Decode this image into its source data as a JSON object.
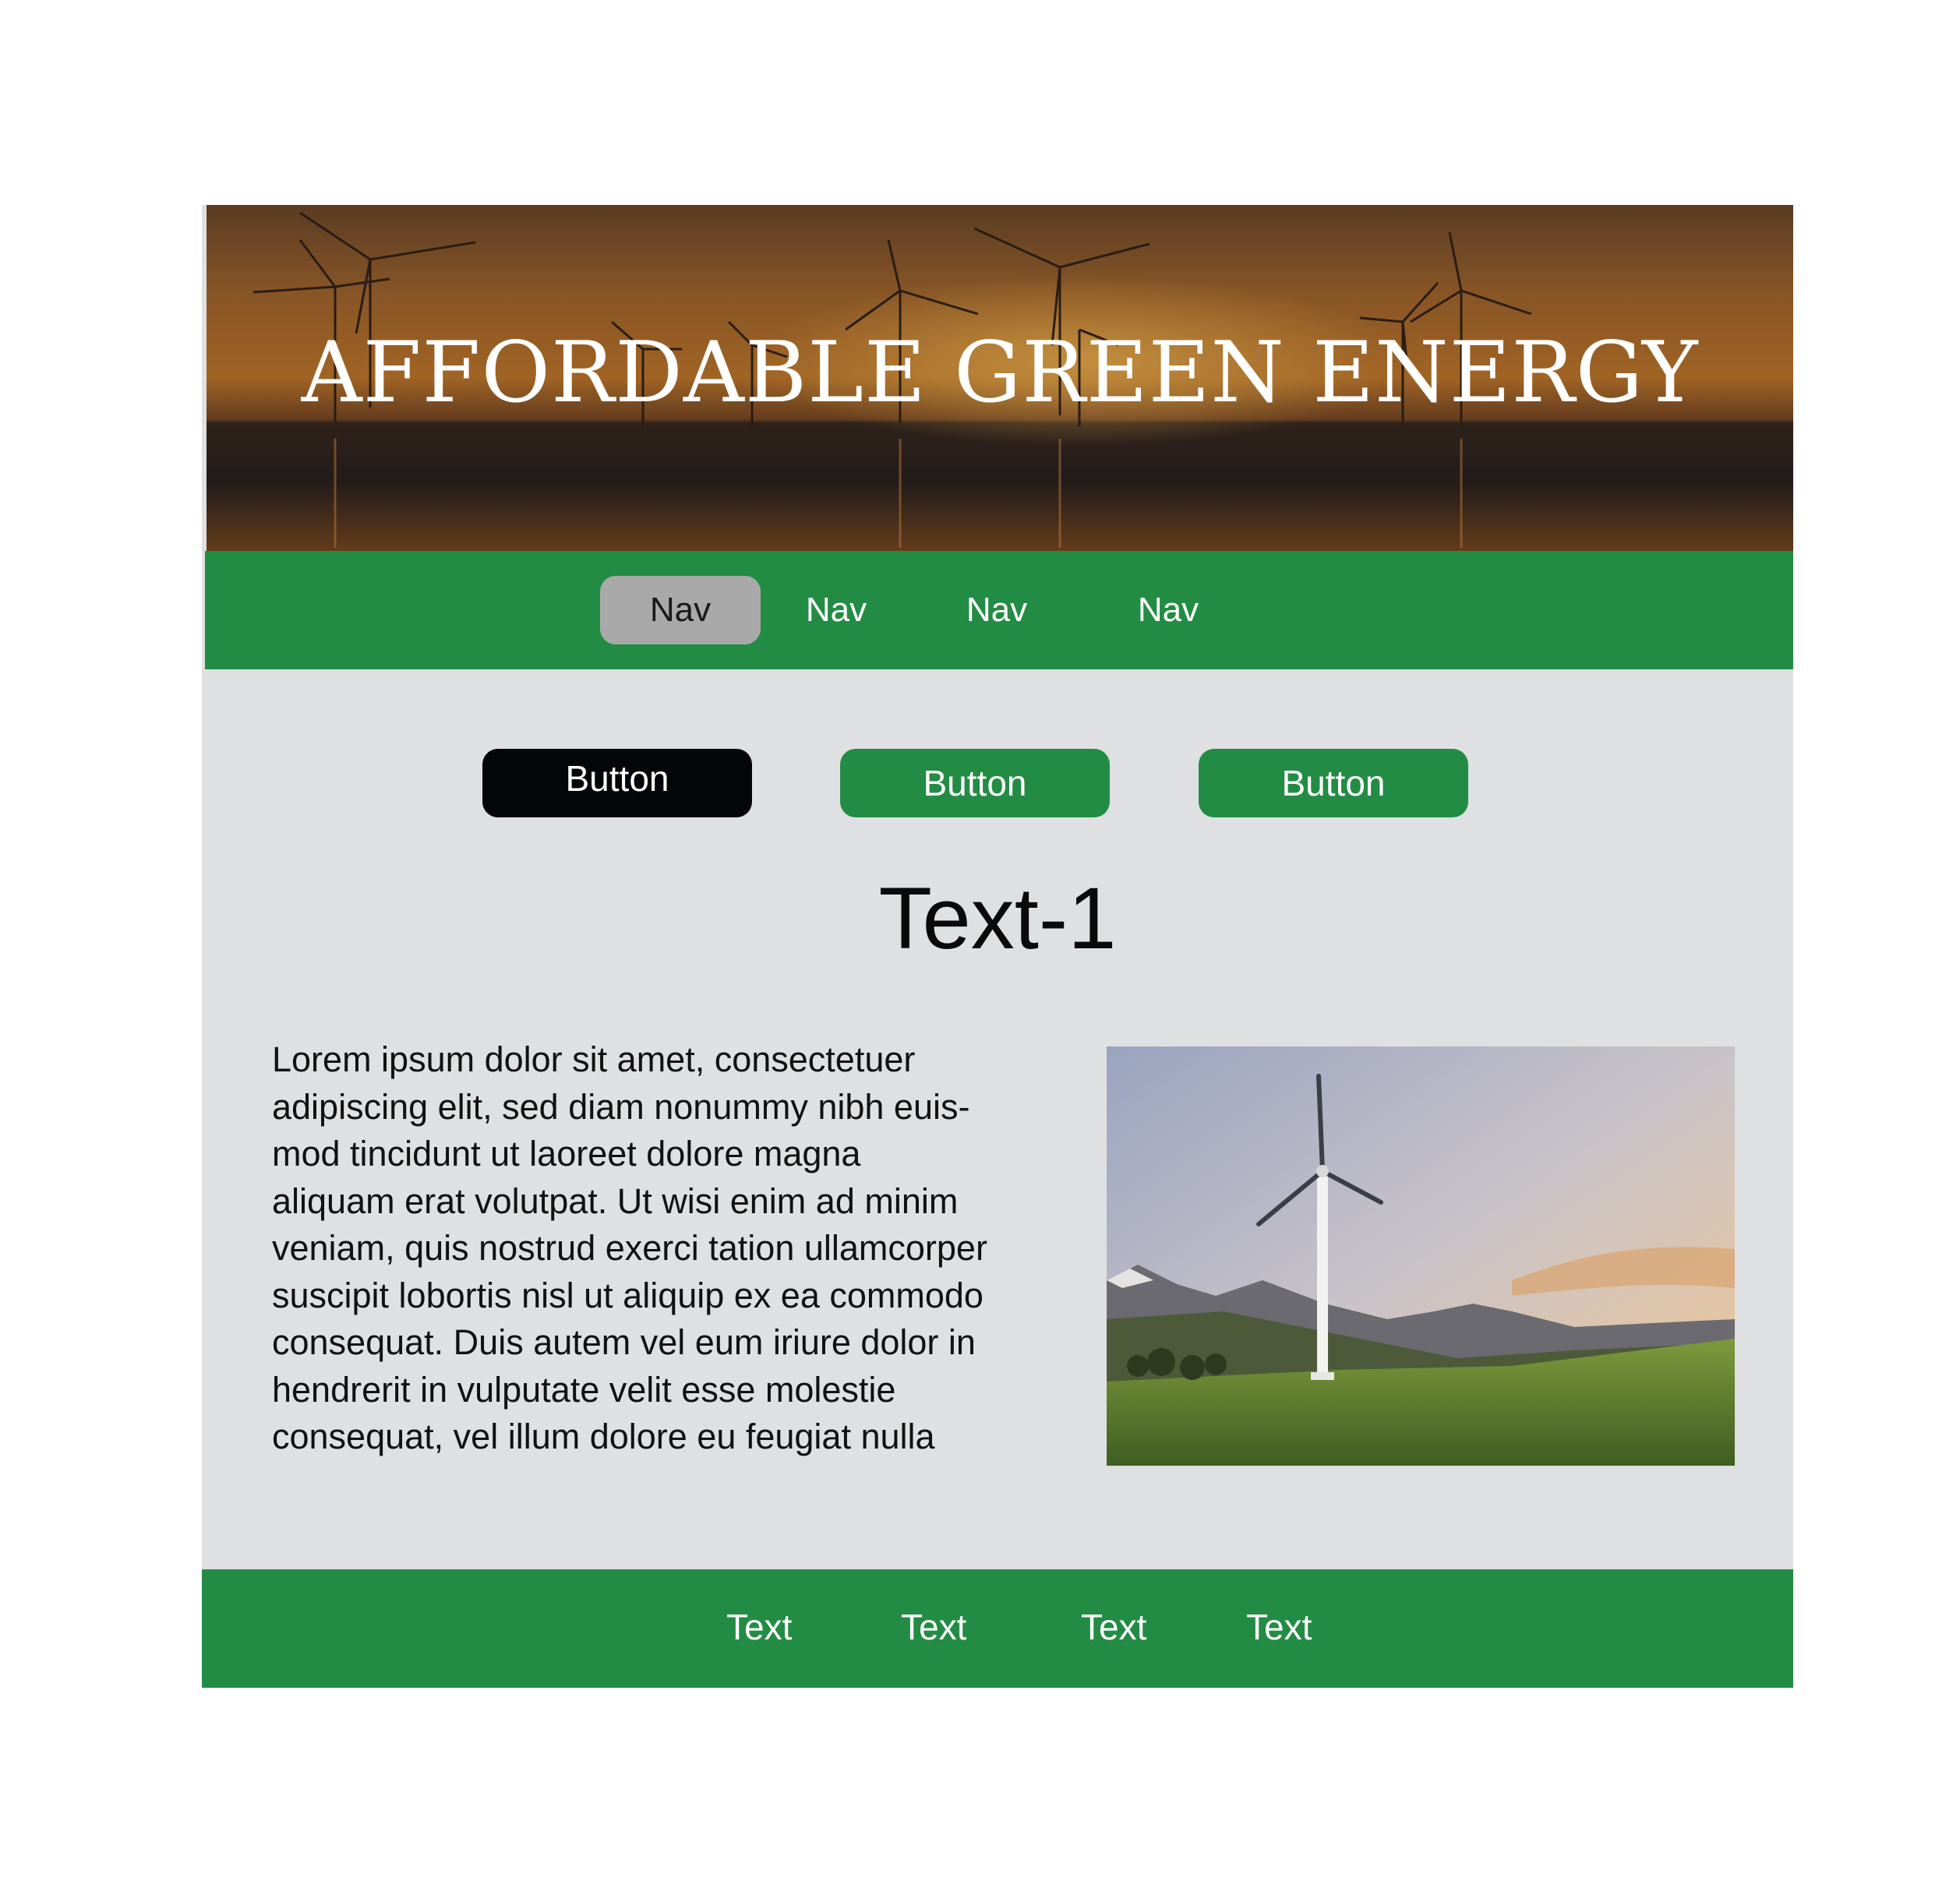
{
  "hero": {
    "title": "AFFORDABLE GREEN ENERGY"
  },
  "nav": {
    "items": [
      {
        "label": "Nav",
        "active": true
      },
      {
        "label": "Nav",
        "active": false
      },
      {
        "label": "Nav",
        "active": false
      },
      {
        "label": "Nav",
        "active": false
      }
    ]
  },
  "buttons": [
    {
      "label": "Button",
      "style": "dark"
    },
    {
      "label": "Button",
      "style": "green"
    },
    {
      "label": "Button",
      "style": "green"
    }
  ],
  "content": {
    "heading": "Text-1",
    "body": "Lorem ipsum dolor sit amet, consectetuer\nadipiscing elit, sed diam nonummy nibh euis-\nmod tincidunt ut laoreet dolore magna\naliquam erat volutpat. Ut wisi enim ad minim\nveniam, quis nostrud exerci tation ullamcorper\nsuscipit lobortis nisl ut aliquip ex ea commodo\nconsequat. Duis autem vel eum iriure dolor in\nhendrerit in vulputate velit esse molestie\nconsequat, vel illum dolore eu feugiat nulla"
  },
  "footer": {
    "items": [
      "Text",
      "Text",
      "Text",
      "Text"
    ]
  },
  "colors": {
    "brand_green": "#238c44",
    "page_background": "#dfe0e1",
    "active_nav": "#a9a9a9",
    "dark_button": "#050607"
  }
}
